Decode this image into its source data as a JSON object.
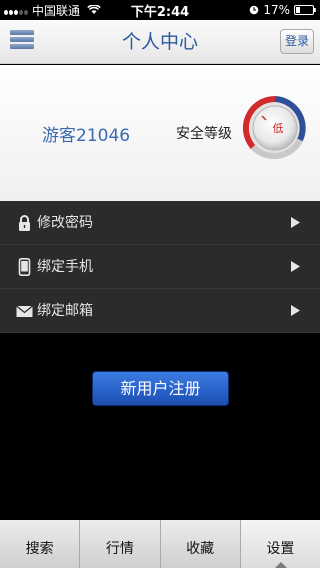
{
  "status_bar": {
    "carrier": "中国联通",
    "time": "下午2:44",
    "battery": "17%"
  },
  "nav": {
    "title": "个人中心",
    "login_label": "登录"
  },
  "profile": {
    "username": "游客21046",
    "security_label": "安全等级",
    "security_level": "低"
  },
  "menu": {
    "items": [
      {
        "label": "修改密码",
        "icon": "lock-icon"
      },
      {
        "label": "绑定手机",
        "icon": "phone-icon"
      },
      {
        "label": "绑定邮箱",
        "icon": "mail-icon"
      }
    ]
  },
  "register_label": "新用户注册",
  "tabs": [
    {
      "label": "搜索"
    },
    {
      "label": "行情"
    },
    {
      "label": "收藏"
    },
    {
      "label": "设置",
      "active": true
    }
  ],
  "colors": {
    "accent": "#2c5aa0",
    "menu_bg": "#2b2b2b",
    "button": "#2a64cc",
    "gauge_red": "#d12a2a"
  }
}
